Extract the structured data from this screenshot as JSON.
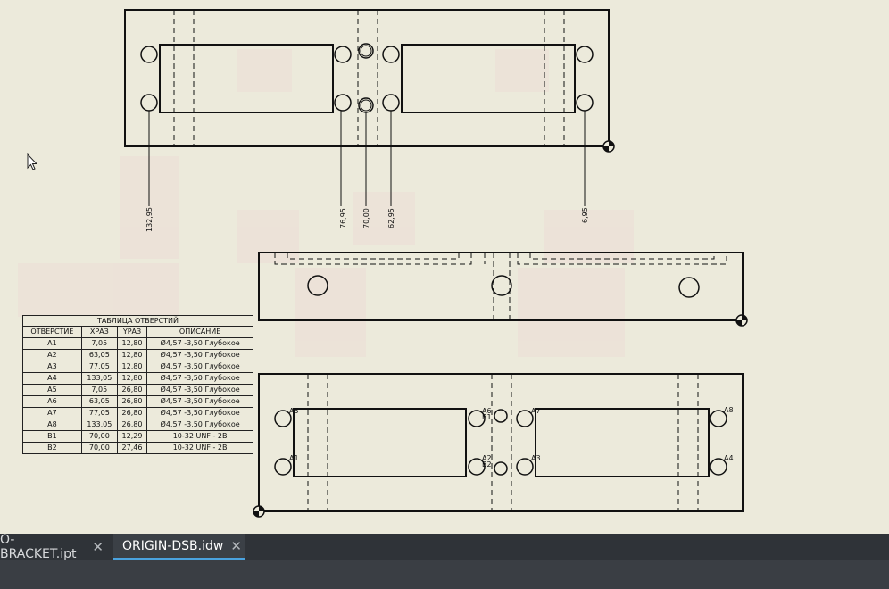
{
  "dimensions": [
    "132,95",
    "76,95",
    "70,00",
    "62,95",
    "6,95"
  ],
  "hole_labels": [
    "A5",
    "A1",
    "A6",
    "B1",
    "A2",
    "B2",
    "A7",
    "A3",
    "A8",
    "A4"
  ],
  "hole_table": {
    "title": "ТАБЛИЦА ОТВЕРСТИЙ",
    "headers": [
      "ОТВЕРСТИЕ",
      "XРАЗ",
      "YРАЗ",
      "ОПИСАНИЕ"
    ],
    "rows": [
      [
        "A1",
        "7,05",
        "12,80",
        "Ø4,57 -3,50 Глубокое"
      ],
      [
        "A2",
        "63,05",
        "12,80",
        "Ø4,57 -3,50 Глубокое"
      ],
      [
        "A3",
        "77,05",
        "12,80",
        "Ø4,57 -3,50 Глубокое"
      ],
      [
        "A4",
        "133,05",
        "12,80",
        "Ø4,57 -3,50 Глубокое"
      ],
      [
        "A5",
        "7,05",
        "26,80",
        "Ø4,57 -3,50 Глубокое"
      ],
      [
        "A6",
        "63,05",
        "26,80",
        "Ø4,57 -3,50 Глубокое"
      ],
      [
        "A7",
        "77,05",
        "26,80",
        "Ø4,57 -3,50 Глубокое"
      ],
      [
        "A8",
        "133,05",
        "26,80",
        "Ø4,57 -3,50 Глубокое"
      ],
      [
        "B1",
        "70,00",
        "12,29",
        "10-32 UNF - 2B"
      ],
      [
        "B2",
        "70,00",
        "27,46",
        "10-32 UNF - 2B"
      ]
    ]
  },
  "tabs": [
    {
      "label": "O-BRACKET.ipt",
      "active": false
    },
    {
      "label": "ORIGIN-DSB.idw",
      "active": true
    }
  ],
  "close_glyph": "✕",
  "colors": {
    "sheet": "#eceadb",
    "tabbar": "#2f3338",
    "accent": "#4aa3df"
  }
}
